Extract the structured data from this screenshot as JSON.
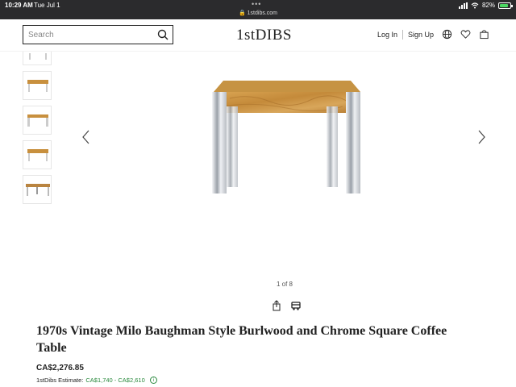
{
  "status_bar": {
    "time": "10:29 AM",
    "date": "Tue Jul 1",
    "url": "1stdibs.com",
    "battery": "82%",
    "battery_level": 0.82
  },
  "header": {
    "search_placeholder": "Search",
    "logo": "1stDIBS",
    "login_label": "Log In",
    "signup_label": "Sign Up"
  },
  "gallery": {
    "counter": "1 of 8"
  },
  "product": {
    "title": "1970s Vintage Milo Baughman Style Burlwood and Chrome Square Coffee Table",
    "price": "CA$2,276.85",
    "estimate_label": "1stDibs Estimate:",
    "estimate_range": "CA$1,740 - CA$2,610",
    "info": "i"
  },
  "colors": {
    "accent_green": "#2a8a3e",
    "burl": "#c8903e",
    "chrome": "#d9dce0"
  }
}
